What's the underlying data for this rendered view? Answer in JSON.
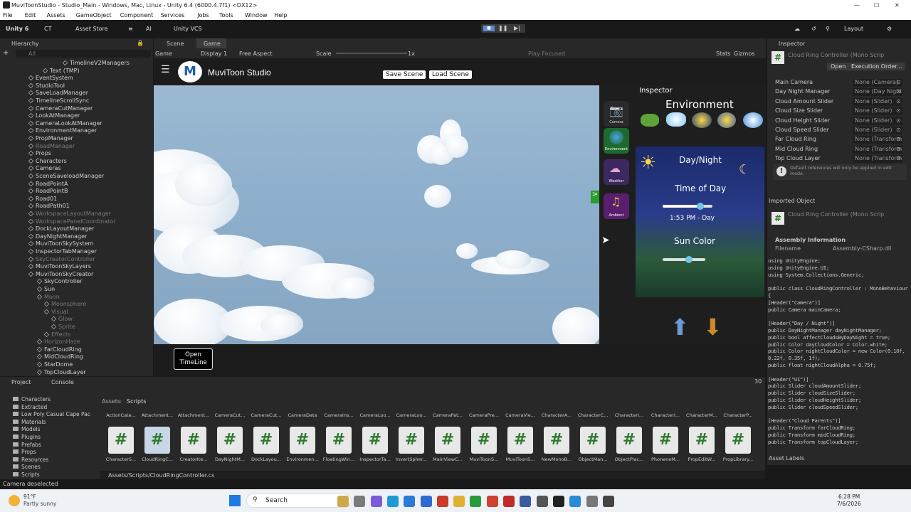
{
  "window": {
    "title": "MuviToonStudio - Studio_Main - Windows, Mac, Linux - Unity 6.4 (6000.4.7f1) <DX12>"
  },
  "menu": [
    "File",
    "Edit",
    "Assets",
    "GameObject",
    "Component",
    "Services",
    "Jobs",
    "Tools",
    "Window",
    "Help"
  ],
  "toolbar": {
    "unity": "Unity 6",
    "account": "CT",
    "asset_store": "Asset Store",
    "ai": "AI",
    "vcs": "Unity VCS",
    "layout": "Layout"
  },
  "hierarchy": {
    "tab": "Hierarchy",
    "search": "All",
    "items": [
      {
        "label": "TimelineV2Managers",
        "dim": false,
        "indent": 88
      },
      {
        "label": "Text (TMP)",
        "dim": false,
        "indent": 60
      },
      {
        "label": "EventSystem",
        "dim": false,
        "indent": 40
      },
      {
        "label": "StudioTool",
        "dim": false,
        "indent": 40
      },
      {
        "label": "SaveLoadManager",
        "dim": false,
        "indent": 40
      },
      {
        "label": "TimelineScrollSync",
        "dim": false,
        "indent": 40
      },
      {
        "label": "CameraCutManager",
        "dim": false,
        "indent": 40
      },
      {
        "label": "LookAtManager",
        "dim": false,
        "indent": 40
      },
      {
        "label": "CameraLookAtManager",
        "dim": false,
        "indent": 40
      },
      {
        "label": "EnvironmentManager",
        "dim": false,
        "indent": 40
      },
      {
        "label": "PropManager",
        "dim": false,
        "indent": 40
      },
      {
        "label": "RoadManager",
        "dim": true,
        "indent": 40
      },
      {
        "label": "Props",
        "dim": false,
        "indent": 40
      },
      {
        "label": "Characters",
        "dim": false,
        "indent": 40
      },
      {
        "label": "Cameras",
        "dim": false,
        "indent": 40
      },
      {
        "label": "SceneSaveloadManager",
        "dim": false,
        "indent": 40
      },
      {
        "label": "RoadPointA",
        "dim": false,
        "indent": 40
      },
      {
        "label": "RoadPointB",
        "dim": false,
        "indent": 40
      },
      {
        "label": "Road01",
        "dim": false,
        "indent": 40
      },
      {
        "label": "RoadPath01",
        "dim": false,
        "indent": 40
      },
      {
        "label": "WorkspaceLayoutManager",
        "dim": true,
        "indent": 40
      },
      {
        "label": "WorkspacePanelCoordinator",
        "dim": true,
        "indent": 40
      },
      {
        "label": "DockLayoutManager",
        "dim": false,
        "indent": 40
      },
      {
        "label": "DayNightManager",
        "dim": false,
        "indent": 40
      },
      {
        "label": "MuviToonSkySystem",
        "dim": false,
        "indent": 40
      },
      {
        "label": "InspectorTabManager",
        "dim": false,
        "indent": 40
      },
      {
        "label": "SkyCreatorController",
        "dim": true,
        "indent": 40
      },
      {
        "label": "MuviToonSkyLayers",
        "dim": false,
        "indent": 40
      },
      {
        "label": "MuviToonSkyCreator",
        "dim": false,
        "indent": 40
      },
      {
        "label": "SkyController",
        "dim": false,
        "indent": 52
      },
      {
        "label": "Sun",
        "dim": false,
        "indent": 52
      },
      {
        "label": "Moon",
        "dim": true,
        "indent": 52
      },
      {
        "label": "Moonsphere",
        "dim": true,
        "indent": 62
      },
      {
        "label": "Visual",
        "dim": true,
        "indent": 62
      },
      {
        "label": "Glow",
        "dim": true,
        "indent": 72
      },
      {
        "label": "Sprite",
        "dim": true,
        "indent": 72
      },
      {
        "label": "Effects",
        "dim": true,
        "indent": 62
      },
      {
        "label": "HorizonHaze",
        "dim": true,
        "indent": 52
      },
      {
        "label": "FarCloudRing",
        "dim": false,
        "indent": 52
      },
      {
        "label": "MidCloudRing",
        "dim": false,
        "indent": 52
      },
      {
        "label": "StarDome",
        "dim": false,
        "indent": 52
      },
      {
        "label": "TopCloudLayer",
        "dim": false,
        "indent": 52
      }
    ]
  },
  "tabs": {
    "scene": "Scene",
    "game": "Game"
  },
  "gamebar": {
    "mode": "Game",
    "display": "Display 1",
    "aspect": "Free Aspect",
    "scale_label": "Scale",
    "scale_value": "1x",
    "play_focused": "Play Focused",
    "stats": "Stats",
    "gizmos": "Gizmos"
  },
  "app": {
    "brand": "MuviToon Studio",
    "save": "Save Scene",
    "load": "Load Scene",
    "timeline": "Open TimeLine"
  },
  "side_buttons": [
    "Camera",
    "Environment",
    "Weather",
    "Ambient"
  ],
  "env_panel": {
    "inspector": "Inspector",
    "title": "Environment",
    "daynight": "Day/Night",
    "time_of_day": "Time of Day",
    "time_value": "1:53 PM - Day",
    "time_fraction": 0.75,
    "sun_color": "Sun Color",
    "sun_fraction": 0.62
  },
  "inspector": {
    "tab": "Inspector",
    "component": "Cloud Ring Controller (Mono Scrip",
    "open": "Open",
    "exec_order": "Execution Order...",
    "props": [
      {
        "label": "Main Camera",
        "value": "None (Camera)"
      },
      {
        "label": "Day Night Manager",
        "value": "None (Day Night Mana"
      },
      {
        "label": "Cloud Amount Slider",
        "value": "None (Slider)"
      },
      {
        "label": "Cloud Size Slider",
        "value": "None (Slider)"
      },
      {
        "label": "Cloud Height Slider",
        "value": "None (Slider)"
      },
      {
        "label": "Cloud Speed Slider",
        "value": "None (Slider)"
      },
      {
        "label": "Far Cloud Ring",
        "value": "None (Transform)"
      },
      {
        "label": "Mid Cloud Ring",
        "value": "None (Transform)"
      },
      {
        "label": "Top Cloud Layer",
        "value": "None (Transform)"
      }
    ],
    "note": "Default references will only be applied in edit mode.",
    "imported": "Imported Object",
    "component2": "Cloud Ring Controller (Mono Scrip",
    "assembly_info": "Assembly Information",
    "filename_label": "Filename",
    "filename": "Assembly-CSharp.dll",
    "code": [
      "using UnityEngine;",
      "using UnityEngine.UI;",
      "using System.Collections.Generic;",
      "",
      "public class CloudRingController : MonoBehaviour",
      "{",
      "    [Header(\"Camera\")]",
      "    public Camera mainCamera;",
      "",
      "    [Header(\"Day / Night\")]",
      "    public DayNightManager dayNightManager;",
      "    public bool affectCloudsByDayNight = true;",
      "    public Color dayCloudColor = Color.white;",
      "    public Color nightCloudColor = new Color(0.18f,",
      "0.22f, 0.35f, 1f);",
      "    public float nightCloudAlpha = 0.75f;",
      "",
      "    [Header(\"UI\")]",
      "    public Slider cloudAmountSlider;",
      "    public Slider cloudSizeSlider;",
      "    public Slider cloudHeightSlider;",
      "    public Slider cloudSpeedSlider;",
      "",
      "    [Header(\"Cloud Parents\")]",
      "    public Transform farCloudRing;",
      "    public Transform midCloudRing;",
      "    public Transform topCloudLayer;"
    ],
    "asset_labels": "Asset Labels"
  },
  "project": {
    "tab": "Project",
    "console": "Console",
    "count": "30",
    "breadcrumb_a": "Assets",
    "breadcrumb_b": "Scripts",
    "folders": [
      "Characters",
      "Extracted",
      "Low Poly Casual Cape Pac",
      "Materials",
      "Models",
      "Plugins",
      "Prefabs",
      "Props",
      "Resources",
      "Scenes",
      "Scripts"
    ],
    "top_labels": [
      "ActionCate...",
      "Attachment...",
      "Attachment...",
      "CameraCut...",
      "CameraCut...",
      "CameraData",
      "CameraIns...",
      "CameraLoo...",
      "CameraLoo...",
      "CameraPat...",
      "CameraPre...",
      "CameraVie...",
      "CharacterA...",
      "CharacterC...",
      "CharacterI...",
      "CharacterI...",
      "CharacterM...",
      "CharacterP..."
    ],
    "labels": [
      "CharacterS...",
      "CloudRingC...",
      "CreatorIte...",
      "DayNightM...",
      "DockLayou...",
      "Environmen...",
      "FloatingWin...",
      "InspectorTa...",
      "InvertSpher...",
      "MainViewC...",
      "MuviToonS...",
      "MuviToonS...",
      "NewMonoB...",
      "ObjectMan...",
      "ObjectPlac...",
      "PhoneneM...",
      "PropEditW...",
      "PropLibrary..."
    ],
    "path": "Assets/Scripts/CloudRingController.cs"
  },
  "status": "Camera deselected",
  "taskbar": {
    "temp": "91°F",
    "weather": "Partly sunny",
    "search": "Search",
    "time": "6:28 PM",
    "date": "7/6/2026"
  }
}
